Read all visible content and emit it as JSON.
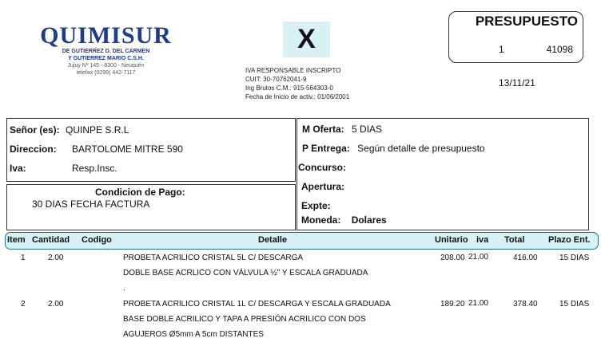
{
  "company": {
    "name": "QUIMISUR",
    "owners_line1": "DE GUTIERREZ D. DEL CARMEN",
    "owners_line2": "Y GUTIERREZ MARIO C.S.H.",
    "address": "Jujuy Nº 145 - 8300 - Neuquén",
    "phone": "telefax (0299) 442-7117"
  },
  "letter_type": "X",
  "tax_info": {
    "line1": "IVA RESPONSABLE INSCRIPTO",
    "line2": "CUIT: 30-70762041-9",
    "line3": "Ing Brutos C.M.: 915-564303-0",
    "line4": "Fecha de Inicio de activ.: 01/06/2001"
  },
  "document": {
    "title": "PRESUPUESTO",
    "point_of_sale": "1",
    "number": "41098",
    "date": "13/11/21"
  },
  "client": {
    "name_label": "Señor (es):",
    "name": "QUINPE S.R.L",
    "address_label": "Direccion:",
    "address": "BARTOLOME MITRE 590",
    "iva_label": "Iva:",
    "iva": "Resp.Insc."
  },
  "payment": {
    "label": "Condicion de Pago:",
    "value": "30 DIAS FECHA FACTURA"
  },
  "offer": {
    "validity_label": "M Oferta:",
    "validity": "5 DIAS",
    "delivery_label": "P Entrega:",
    "delivery": "Según detalle de presupuesto",
    "tender_label": "Concurso:",
    "opening_label": "Apertura:",
    "file_label": "Expte:",
    "currency_label": "Moneda:",
    "currency": "Dolares"
  },
  "table": {
    "headers": {
      "item": "Item",
      "qty": "Cantidad",
      "code": "Codigo",
      "detail": "Detalle",
      "unit": "Unitario",
      "iva": "iva",
      "total": "Total",
      "term": "Plazo Ent."
    },
    "rows": [
      {
        "item": "1",
        "qty": "2.00",
        "code": "",
        "detail1": "PROBETA ACRILICO CRISTAL 5L C/ DESCARGA",
        "detail2": "DOBLE BASE ACRLICO CON VÁLVULA ½\"  Y ESCALA GRADUADA",
        "detail3": ".",
        "unit": "208.00",
        "iva": "21.00",
        "total": "416.00",
        "term": "15 DIAS"
      },
      {
        "item": "2",
        "qty": "2.00",
        "code": "",
        "detail1": "PROBETA ACRILICO CRISTAL 1L C/ DESCARGA Y ESCALA GRADUADA",
        "detail2": "BASE DOBLE ACRILICO Y TAPA A PRESIÓN ACRILICO CON DOS",
        "detail3": "AGUJEROS Ø5mm A 5cm DISTANTES",
        "unit": "189.20",
        "iva": "21.00",
        "total": "378.40",
        "term": "15 DIAS"
      }
    ]
  }
}
